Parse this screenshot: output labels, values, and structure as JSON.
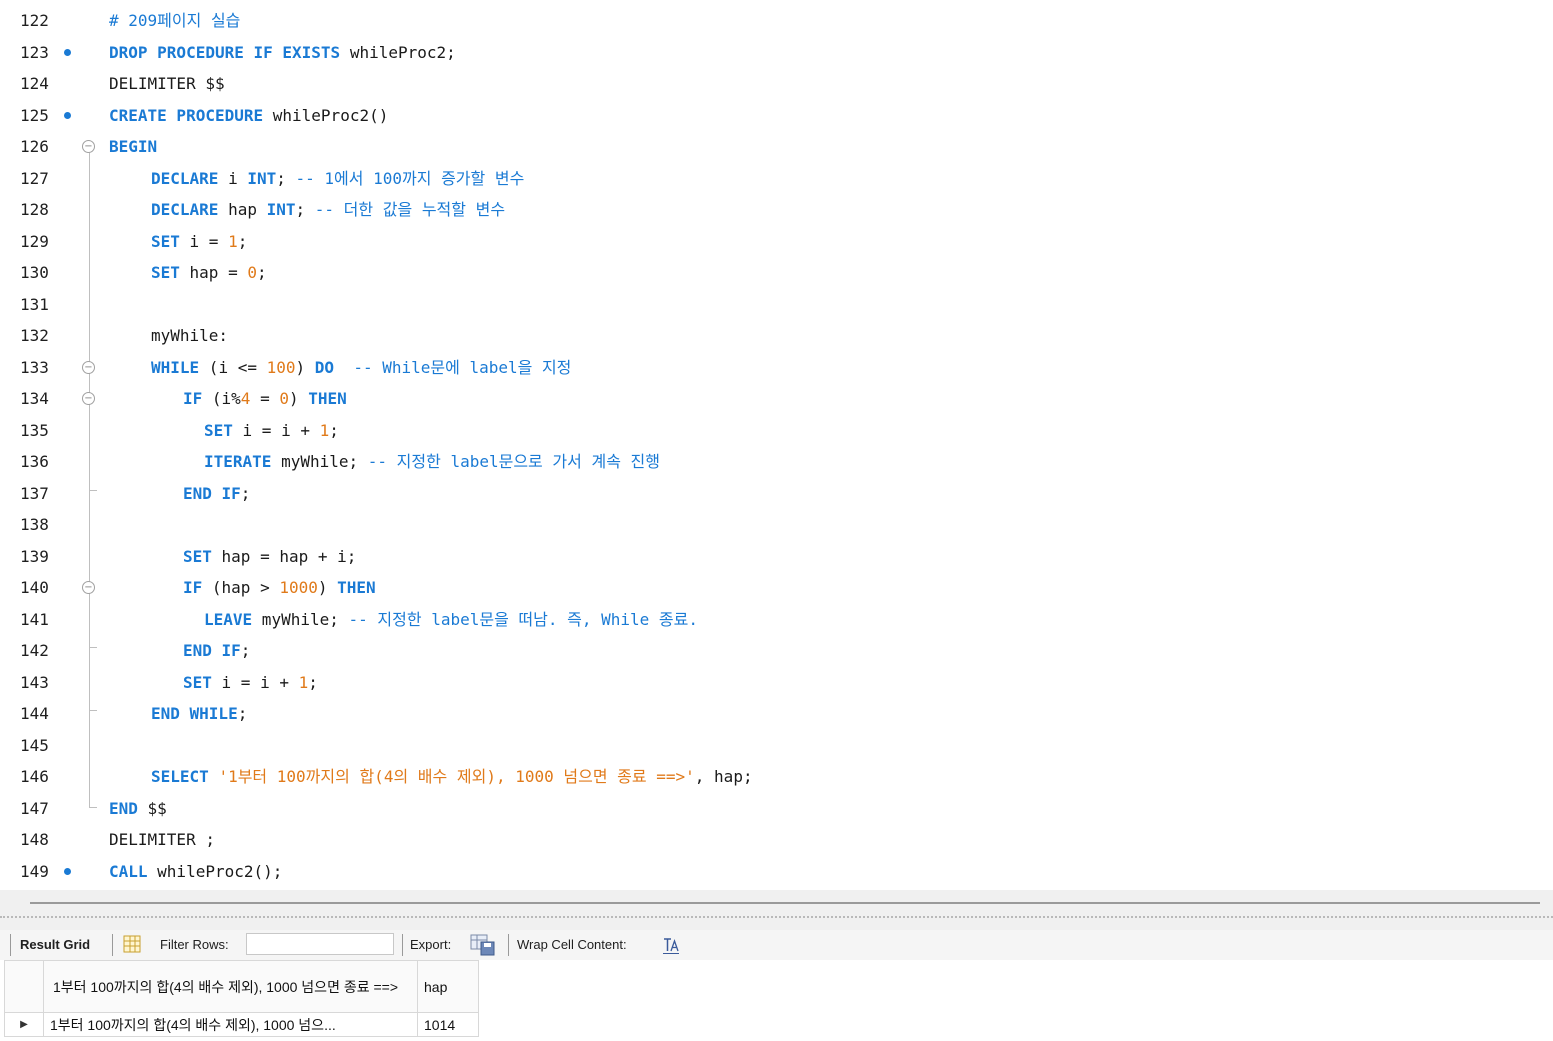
{
  "editor": {
    "lines": [
      {
        "n": "122",
        "dot": false,
        "indent": 0,
        "t": [
          [
            "cm",
            "# 209페이지 실습"
          ]
        ]
      },
      {
        "n": "123",
        "dot": true,
        "indent": 0,
        "t": [
          [
            "kw",
            "DROP PROCEDURE IF EXISTS"
          ],
          [
            "tx",
            " whileProc2;"
          ]
        ]
      },
      {
        "n": "124",
        "dot": false,
        "indent": 0,
        "t": [
          [
            "tx",
            "DELIMITER $$"
          ]
        ]
      },
      {
        "n": "125",
        "dot": true,
        "indent": 0,
        "t": [
          [
            "kw",
            "CREATE PROCEDURE"
          ],
          [
            "tx",
            " whileProc2()"
          ]
        ]
      },
      {
        "n": "126",
        "dot": false,
        "indent": 0,
        "t": [
          [
            "kw",
            "BEGIN"
          ]
        ]
      },
      {
        "n": "127",
        "dot": false,
        "indent": 1,
        "t": [
          [
            "kw",
            "DECLARE"
          ],
          [
            "tx",
            " i "
          ],
          [
            "kw",
            "INT"
          ],
          [
            "tx",
            "; "
          ],
          [
            "cm",
            "-- 1에서 100까지 증가할 변수"
          ]
        ]
      },
      {
        "n": "128",
        "dot": false,
        "indent": 1,
        "t": [
          [
            "kw",
            "DECLARE"
          ],
          [
            "tx",
            " hap "
          ],
          [
            "kw",
            "INT"
          ],
          [
            "tx",
            "; "
          ],
          [
            "cm",
            "-- 더한 값을 누적할 변수"
          ]
        ]
      },
      {
        "n": "129",
        "dot": false,
        "indent": 1,
        "t": [
          [
            "kw",
            "SET"
          ],
          [
            "tx",
            " i = "
          ],
          [
            "num",
            "1"
          ],
          [
            "tx",
            ";"
          ]
        ]
      },
      {
        "n": "130",
        "dot": false,
        "indent": 1,
        "t": [
          [
            "kw",
            "SET"
          ],
          [
            "tx",
            " hap = "
          ],
          [
            "num",
            "0"
          ],
          [
            "tx",
            ";"
          ]
        ]
      },
      {
        "n": "131",
        "dot": false,
        "indent": 1,
        "t": []
      },
      {
        "n": "132",
        "dot": false,
        "indent": 1,
        "t": [
          [
            "tx",
            "myWhile:"
          ]
        ]
      },
      {
        "n": "133",
        "dot": false,
        "indent": 1,
        "t": [
          [
            "kw",
            "WHILE"
          ],
          [
            "tx",
            " (i <= "
          ],
          [
            "num",
            "100"
          ],
          [
            "tx",
            ") "
          ],
          [
            "kw",
            "DO"
          ],
          [
            "tx",
            "  "
          ],
          [
            "cm",
            "-- While문에 label을 지정"
          ]
        ]
      },
      {
        "n": "134",
        "dot": false,
        "indent": 2,
        "t": [
          [
            "kw",
            "IF"
          ],
          [
            "tx",
            " (i%"
          ],
          [
            "num",
            "4"
          ],
          [
            "tx",
            " = "
          ],
          [
            "num",
            "0"
          ],
          [
            "tx",
            ") "
          ],
          [
            "kw",
            "THEN"
          ]
        ]
      },
      {
        "n": "135",
        "dot": false,
        "indent": 3,
        "t": [
          [
            "kw",
            "SET"
          ],
          [
            "tx",
            " i = i + "
          ],
          [
            "num",
            "1"
          ],
          [
            "tx",
            ";"
          ]
        ]
      },
      {
        "n": "136",
        "dot": false,
        "indent": 3,
        "t": [
          [
            "kw",
            "ITERATE"
          ],
          [
            "tx",
            " myWhile; "
          ],
          [
            "cm",
            "-- 지정한 label문으로 가서 계속 진행"
          ]
        ]
      },
      {
        "n": "137",
        "dot": false,
        "indent": 2,
        "t": [
          [
            "kw",
            "END IF"
          ],
          [
            "tx",
            ";"
          ]
        ]
      },
      {
        "n": "138",
        "dot": false,
        "indent": 2,
        "t": []
      },
      {
        "n": "139",
        "dot": false,
        "indent": 2,
        "t": [
          [
            "kw",
            "SET"
          ],
          [
            "tx",
            " hap = hap + i;"
          ]
        ]
      },
      {
        "n": "140",
        "dot": false,
        "indent": 2,
        "t": [
          [
            "kw",
            "IF"
          ],
          [
            "tx",
            " (hap > "
          ],
          [
            "num",
            "1000"
          ],
          [
            "tx",
            ") "
          ],
          [
            "kw",
            "THEN"
          ]
        ]
      },
      {
        "n": "141",
        "dot": false,
        "indent": 3,
        "t": [
          [
            "kw",
            "LEAVE"
          ],
          [
            "tx",
            " myWhile; "
          ],
          [
            "cm",
            "-- 지정한 label문을 떠남. 즉, While 종료."
          ]
        ]
      },
      {
        "n": "142",
        "dot": false,
        "indent": 2,
        "t": [
          [
            "kw",
            "END IF"
          ],
          [
            "tx",
            ";"
          ]
        ]
      },
      {
        "n": "143",
        "dot": false,
        "indent": 2,
        "t": [
          [
            "kw",
            "SET"
          ],
          [
            "tx",
            " i = i + "
          ],
          [
            "num",
            "1"
          ],
          [
            "tx",
            ";"
          ]
        ]
      },
      {
        "n": "144",
        "dot": false,
        "indent": 1,
        "t": [
          [
            "kw",
            "END WHILE"
          ],
          [
            "tx",
            ";"
          ]
        ]
      },
      {
        "n": "145",
        "dot": false,
        "indent": 1,
        "t": []
      },
      {
        "n": "146",
        "dot": false,
        "indent": 1,
        "t": [
          [
            "kw",
            "SELECT"
          ],
          [
            "tx",
            " "
          ],
          [
            "str",
            "'1부터 100까지의 합(4의 배수 제외), 1000 넘으면 종료 ==>'"
          ],
          [
            "tx",
            ", hap;"
          ]
        ]
      },
      {
        "n": "147",
        "dot": false,
        "indent": 0,
        "t": [
          [
            "kw",
            "END"
          ],
          [
            "tx",
            " $$"
          ]
        ]
      },
      {
        "n": "148",
        "dot": false,
        "indent": 0,
        "t": [
          [
            "tx",
            "DELIMITER ;"
          ]
        ]
      },
      {
        "n": "149",
        "dot": true,
        "indent": 0,
        "t": [
          [
            "kw",
            "CALL"
          ],
          [
            "tx",
            " whileProc2();"
          ]
        ]
      }
    ]
  },
  "toolbar": {
    "result_grid_label": "Result Grid",
    "grid_icon": "grid-icon",
    "filter_label": "Filter Rows:",
    "filter_value": "",
    "export_label": "Export:",
    "export_icon": "export-icon",
    "wrap_label": "Wrap Cell Content:",
    "wrap_icon": "wrap-icon"
  },
  "result": {
    "headers": [
      "1부터 100까지의 합(4의 배수 제외), 1000 넘으면 종료 ==>",
      "hap"
    ],
    "rows": [
      [
        "1부터 100까지의 합(4의 배수 제외), 1000 넘으...",
        "1014"
      ]
    ]
  },
  "colors": {
    "keyword": "#1a7ad4",
    "number": "#e07a1a",
    "breakpoint": "#1a7ad4"
  }
}
